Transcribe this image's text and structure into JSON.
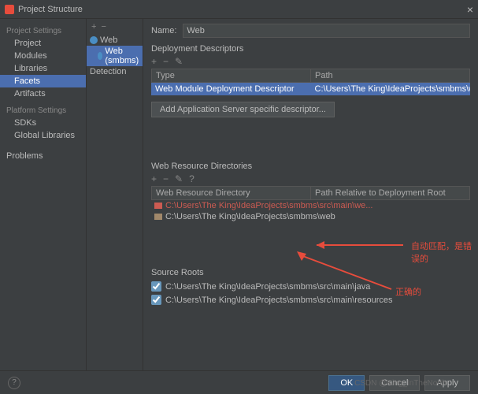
{
  "window": {
    "title": "Project Structure",
    "close": "×"
  },
  "sidebar": {
    "projectSettings": "Project Settings",
    "items1": [
      "Project",
      "Modules",
      "Libraries",
      "Facets",
      "Artifacts"
    ],
    "platformSettings": "Platform Settings",
    "items2": [
      "SDKs",
      "Global Libraries"
    ],
    "problems": "Problems"
  },
  "middle": {
    "add": "+",
    "remove": "−",
    "tree": {
      "root": "Web",
      "child": "Web (smbms)",
      "detection": "Detection"
    }
  },
  "content": {
    "nameLabel": "Name:",
    "nameValue": "Web",
    "deploymentDescriptors": "Deployment Descriptors",
    "tb": {
      "add": "+",
      "remove": "−",
      "edit": "✎"
    },
    "cols": {
      "type": "Type",
      "path": "Path"
    },
    "ddRow": {
      "type": "Web Module Deployment Descriptor",
      "path": "C:\\Users\\The King\\IdeaProjects\\smbms\\web\\WEB-INF\\web"
    },
    "addAppServer": "Add Application Server specific descriptor...",
    "webResourceDirs": "Web Resource Directories",
    "tb2": {
      "add": "+",
      "remove": "−",
      "edit": "✎",
      "help": "?"
    },
    "wrdCols": {
      "dir": "Web Resource Directory",
      "rel": "Path Relative to Deployment Root"
    },
    "wrdRows": [
      {
        "path": "C:\\Users\\The King\\IdeaProjects\\smbms\\src\\main\\we...",
        "rel": "/"
      },
      {
        "path": "C:\\Users\\The King\\IdeaProjects\\smbms\\web",
        "rel": "/"
      }
    ],
    "sourceRoots": "Source Roots",
    "roots": [
      "C:\\Users\\The King\\IdeaProjects\\smbms\\src\\main\\java",
      "C:\\Users\\The King\\IdeaProjects\\smbms\\src\\main\\resources"
    ]
  },
  "annotations": {
    "auto": "自动匹配，是错误的",
    "correct": "正确的"
  },
  "footer": {
    "ok": "OK",
    "cancel": "Cancel",
    "apply": "Apply",
    "help": "?"
  },
  "watermark": "CSDN @King_InTheNorth"
}
